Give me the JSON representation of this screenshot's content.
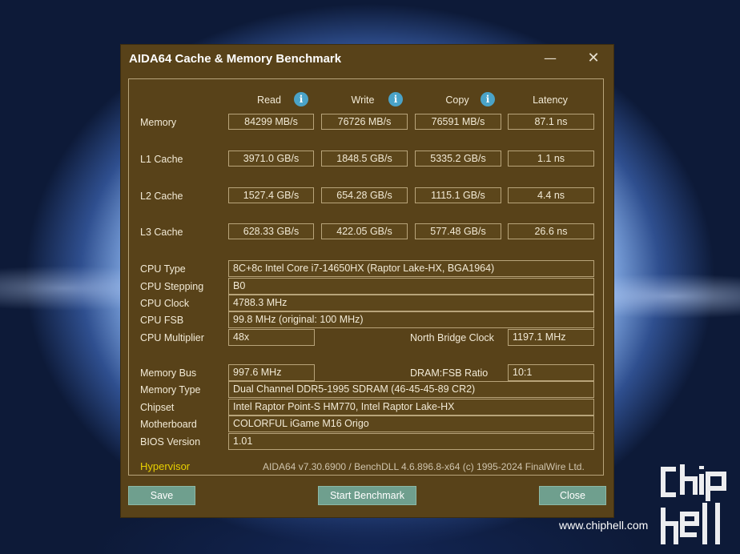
{
  "window": {
    "title": "AIDA64 Cache & Memory Benchmark",
    "minimize_glyph": "—",
    "close_glyph": "✕"
  },
  "columns": {
    "read": "Read",
    "write": "Write",
    "copy": "Copy",
    "latency": "Latency",
    "info_glyph": "i"
  },
  "benchmarks": [
    {
      "label": "Memory",
      "read": "84299 MB/s",
      "write": "76726 MB/s",
      "copy": "76591 MB/s",
      "latency": "87.1 ns"
    },
    {
      "label": "L1 Cache",
      "read": "3971.0 GB/s",
      "write": "1848.5 GB/s",
      "copy": "5335.2 GB/s",
      "latency": "1.1 ns"
    },
    {
      "label": "L2 Cache",
      "read": "1527.4 GB/s",
      "write": "654.28 GB/s",
      "copy": "1115.1 GB/s",
      "latency": "4.4 ns"
    },
    {
      "label": "L3 Cache",
      "read": "628.33 GB/s",
      "write": "422.05 GB/s",
      "copy": "577.48 GB/s",
      "latency": "26.6 ns"
    }
  ],
  "cpu": {
    "type_label": "CPU Type",
    "type_value": "8C+8c Intel Core i7-14650HX  (Raptor Lake-HX, BGA1964)",
    "stepping_label": "CPU Stepping",
    "stepping_value": "B0",
    "clock_label": "CPU Clock",
    "clock_value": "4788.3 MHz",
    "fsb_label": "CPU FSB",
    "fsb_value": "99.8 MHz  (original: 100 MHz)",
    "multiplier_label": "CPU Multiplier",
    "multiplier_value": "48x",
    "nb_clock_label": "North Bridge Clock",
    "nb_clock_value": "1197.1 MHz"
  },
  "memory": {
    "bus_label": "Memory Bus",
    "bus_value": "997.6 MHz",
    "ratio_label": "DRAM:FSB Ratio",
    "ratio_value": "10:1",
    "type_label": "Memory Type",
    "type_value": "Dual Channel DDR5-1995 SDRAM  (46-45-45-89 CR2)",
    "chipset_label": "Chipset",
    "chipset_value": "Intel Raptor Point-S HM770, Intel Raptor Lake-HX",
    "motherboard_label": "Motherboard",
    "motherboard_value": "COLORFUL iGame M16 Origo",
    "bios_label": "BIOS Version",
    "bios_value": "1.01"
  },
  "footer": {
    "hypervisor": "Hypervisor",
    "version": "AIDA64 v7.30.6900 / BenchDLL 4.6.896.8-x64  (c) 1995-2024 FinalWire Ltd."
  },
  "buttons": {
    "save": "Save",
    "start": "Start Benchmark",
    "close": "Close"
  },
  "watermark": {
    "url": "www.chiphell.com",
    "logo_text": "chiphell"
  },
  "colors": {
    "window_bg": "#584219",
    "border": "#b8a47a",
    "button_bg": "#6f9f8e",
    "info_icon": "#4aa3c8",
    "hypervisor_text": "#e8d000"
  }
}
